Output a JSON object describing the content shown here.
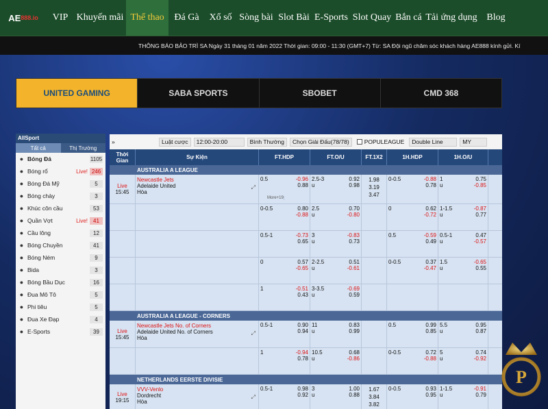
{
  "logo": {
    "main": "AE",
    "accent": "888.io"
  },
  "nav": [
    {
      "label": "VIP",
      "active": false
    },
    {
      "label": "Khuyến mãi",
      "active": false
    },
    {
      "label": "Thể thao",
      "active": true
    },
    {
      "label": "Đá Gà",
      "active": false
    },
    {
      "label": "Xổ số",
      "active": false
    },
    {
      "label": "Sòng bài",
      "active": false
    },
    {
      "label": "Slot Bài",
      "active": false
    },
    {
      "label": "E-Sports",
      "active": false
    },
    {
      "label": "Slot Quay",
      "active": false
    },
    {
      "label": "Bắn cá",
      "active": false
    },
    {
      "label": "Tải ứng dụng",
      "active": false
    },
    {
      "label": "Blog",
      "active": false
    }
  ],
  "notice": "THÔNG BÁO BẢO TRÌ SA Ngày 31 tháng 01 năm 2022 Thời gian: 09:00 - 11:30 (GMT+7) Từ: SA Đội ngũ chăm sóc khách hàng AE888 kính gửi. Kí",
  "providers": [
    {
      "label": "UNITED GAMING",
      "active": true
    },
    {
      "label": "SABA SPORTS",
      "active": false
    },
    {
      "label": "SBOBET",
      "active": false
    },
    {
      "label": "CMD 368",
      "active": false
    }
  ],
  "sidebar": {
    "title": "AllSport",
    "tabs": [
      "Tất cả",
      "Thị Trường"
    ],
    "items": [
      {
        "icon": "soccer-icon",
        "label": "Bóng Đá",
        "live": "",
        "count": "1105",
        "selected": true
      },
      {
        "icon": "basketball-icon",
        "label": "Bóng rổ",
        "live": "Live!",
        "count": "246",
        "selected": false
      },
      {
        "icon": "football-icon",
        "label": "Bóng Đá Mỹ",
        "live": "",
        "count": "5",
        "selected": false
      },
      {
        "icon": "baseball-icon",
        "label": "Bóng chày",
        "live": "",
        "count": "3",
        "selected": false
      },
      {
        "icon": "hockey-icon",
        "label": "Khúc côn cầu",
        "live": "",
        "count": "53",
        "selected": false
      },
      {
        "icon": "tennis-icon",
        "label": "Quần Vợt",
        "live": "Live!",
        "count": "41",
        "selected": false
      },
      {
        "icon": "badminton-icon",
        "label": "Cầu lông",
        "live": "",
        "count": "12",
        "selected": false
      },
      {
        "icon": "volleyball-icon",
        "label": "Bóng Chuyền",
        "live": "",
        "count": "41",
        "selected": false
      },
      {
        "icon": "handball-icon",
        "label": "Bóng Ném",
        "live": "",
        "count": "9",
        "selected": false
      },
      {
        "icon": "billiards-icon",
        "label": "Bida",
        "live": "",
        "count": "3",
        "selected": false
      },
      {
        "icon": "rugby-icon",
        "label": "Bóng Bầu Dục",
        "live": "",
        "count": "16",
        "selected": false
      },
      {
        "icon": "motorbike-icon",
        "label": "Đua Mô Tô",
        "live": "",
        "count": "5",
        "selected": false
      },
      {
        "icon": "darts-icon",
        "label": "Phi tiêu",
        "live": "",
        "count": "5",
        "selected": false
      },
      {
        "icon": "cycling-icon",
        "label": "Đua Xe Đạp",
        "live": "",
        "count": "4",
        "selected": false
      },
      {
        "icon": "esports-icon",
        "label": "E-Sports",
        "live": "",
        "count": "39",
        "selected": false
      }
    ]
  },
  "filters": {
    "collapse": "»",
    "bet_type_label": "Luật cược",
    "time_range": "12:00-20:00",
    "mode": "Bình Thường",
    "select_league": "Chọn Giải Đấu(78/78)",
    "popular_league": "POPULEAGUE",
    "line_type": "Double Line",
    "odds_format": "MY"
  },
  "grid": {
    "headers": {
      "time": "Thời Gian",
      "event": "Sự Kiện",
      "fthdp": "FT.HDP",
      "ftou": "FT.O/U",
      "ft1x2": "FT.1X2",
      "hhdp": "1H.HDP",
      "hou": "1H.O/U"
    },
    "leagues": [
      {
        "name": "AUSTRALIA A LEAGUE",
        "matches": [
          {
            "live": "Live",
            "time": "15:45",
            "home": "Newcastle Jets",
            "away": "Adelaide United",
            "draw": "Hòa",
            "more": "More+19",
            "lines": [
              {
                "hdp_h": "0.5",
                "hdp_o1": "-0.96",
                "hdp_o2": "0.88",
                "ou_l": "2.5-3",
                "ou_u": "u",
                "ou_o1": "0.92",
                "ou_o2": "0.98",
                "x1": "1.98",
                "x2": "3.19",
                "x3": "3.47",
                "h_hdp": "0-0.5",
                "h_o1": "-0.88",
                "h_o2": "0.78",
                "h_ou": "1",
                "h_ou_u": "u",
                "h_ou1": "0.75",
                "h_ou2": "-0.85"
              },
              {
                "hdp_h": "0-0.5",
                "hdp_o1": "0.80",
                "hdp_o2": "-0.88",
                "ou_l": "2.5",
                "ou_u": "u",
                "ou_o1": "0.70",
                "ou_o2": "-0.80",
                "x1": "",
                "x2": "",
                "x3": "",
                "h_hdp": "0",
                "h_o1": "0.62",
                "h_o2": "-0.72",
                "h_ou": "1-1.5",
                "h_ou_u": "u",
                "h_ou1": "-0.87",
                "h_ou2": "0.77"
              },
              {
                "hdp_h": "0.5-1",
                "hdp_o1": "-0.73",
                "hdp_o2": "0.65",
                "ou_l": "3",
                "ou_u": "u",
                "ou_o1": "-0.83",
                "ou_o2": "0.73",
                "x1": "",
                "x2": "",
                "x3": "",
                "h_hdp": "0.5",
                "h_o1": "-0.59",
                "h_o2": "0.49",
                "h_ou": "0.5-1",
                "h_ou_u": "u",
                "h_ou1": "0.47",
                "h_ou2": "-0.57"
              },
              {
                "hdp_h": "0",
                "hdp_o1": "0.57",
                "hdp_o2": "-0.65",
                "ou_l": "2-2.5",
                "ou_u": "u",
                "ou_o1": "0.51",
                "ou_o2": "-0.61",
                "x1": "",
                "x2": "",
                "x3": "",
                "h_hdp": "0-0.5",
                "h_o1": "0.37",
                "h_o2": "-0.47",
                "h_ou": "1.5",
                "h_ou_u": "u",
                "h_ou1": "-0.65",
                "h_ou2": "0.55"
              },
              {
                "hdp_h": "1",
                "hdp_o1": "-0.51",
                "hdp_o2": "0.43",
                "ou_l": "3-3.5",
                "ou_u": "u",
                "ou_o1": "-0.69",
                "ou_o2": "0.59",
                "x1": "",
                "x2": "",
                "x3": "",
                "h_hdp": "",
                "h_o1": "",
                "h_o2": "",
                "h_ou": "",
                "h_ou_u": "",
                "h_ou1": "",
                "h_ou2": ""
              }
            ]
          }
        ]
      },
      {
        "name": "AUSTRALIA A LEAGUE - CORNERS",
        "matches": [
          {
            "live": "Live",
            "time": "15:45",
            "home": "Newcastle Jets No. of Corners",
            "away": "Adelaide United No. of Corners",
            "draw": "Hòa",
            "more": "",
            "lines": [
              {
                "hdp_h": "0.5-1",
                "hdp_o1": "0.90",
                "hdp_o2": "0.94",
                "ou_l": "11",
                "ou_u": "u",
                "ou_o1": "0.83",
                "ou_o2": "0.99",
                "x1": "",
                "x2": "",
                "x3": "",
                "h_hdp": "0.5",
                "h_o1": "0.99",
                "h_o2": "0.85",
                "h_ou": "5.5",
                "h_ou_u": "u",
                "h_ou1": "0.95",
                "h_ou2": "0.87"
              },
              {
                "hdp_h": "1",
                "hdp_o1": "-0.94",
                "hdp_o2": "0.78",
                "ou_l": "10.5",
                "ou_u": "u",
                "ou_o1": "0.68",
                "ou_o2": "-0.86",
                "x1": "",
                "x2": "",
                "x3": "",
                "h_hdp": "0-0.5",
                "h_o1": "0.72",
                "h_o2": "-0.88",
                "h_ou": "5",
                "h_ou_u": "u",
                "h_ou1": "0.74",
                "h_ou2": "-0.92"
              }
            ]
          }
        ]
      },
      {
        "name": "NETHERLANDS EERSTE DIVISIE",
        "matches": [
          {
            "live": "Live",
            "time": "19:15",
            "home": "VVV-Venlo",
            "away": "Dordrecht",
            "draw": "Hòa",
            "more": "",
            "lines": [
              {
                "hdp_h": "0.5-1",
                "hdp_o1": "0.98",
                "hdp_o2": "0.92",
                "ou_l": "3",
                "ou_u": "u",
                "ou_o1": "1.00",
                "ou_o2": "0.88",
                "x1": "1.67",
                "x2": "3.84",
                "x3": "3.82",
                "h_hdp": "0-0.5",
                "h_o1": "0.93",
                "h_o2": "0.95",
                "h_ou": "1-1.5",
                "h_ou_u": "u",
                "h_ou1": "-0.91",
                "h_ou2": "0.79"
              }
            ]
          }
        ]
      }
    ]
  },
  "colors": {
    "nav_bg": "#1c4d2a",
    "nav_active": "#2f6f3c",
    "accent_gold": "#f5cb3a",
    "header_blue": "#25487a",
    "negative": "#dd1111"
  }
}
